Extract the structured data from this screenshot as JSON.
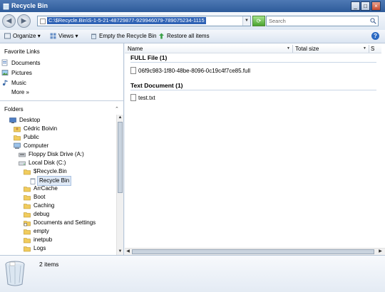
{
  "window": {
    "title": "Recycle Bin"
  },
  "address": {
    "path": "C:\\$Recycle.Bin\\S-1-5-21-48729877-929946079-789075234-1115",
    "search_placeholder": "Search"
  },
  "toolbar": {
    "organize": "Organize",
    "views": "Views",
    "empty": "Empty the Recycle Bin",
    "restore": "Restore all items"
  },
  "favorites": {
    "title": "Favorite Links",
    "items": [
      {
        "label": "Documents"
      },
      {
        "label": "Pictures"
      },
      {
        "label": "Music"
      }
    ],
    "more": "More"
  },
  "folders": {
    "title": "Folders",
    "tree": [
      {
        "label": "Desktop"
      },
      {
        "label": "Cédric Boivin"
      },
      {
        "label": "Public"
      },
      {
        "label": "Computer"
      },
      {
        "label": "Floppy Disk Drive (A:)"
      },
      {
        "label": "Local Disk (C:)"
      },
      {
        "label": "$Recycle.Bin"
      },
      {
        "label": "Recycle Bin"
      },
      {
        "label": "ArrCache"
      },
      {
        "label": "Boot"
      },
      {
        "label": "Caching"
      },
      {
        "label": "debug"
      },
      {
        "label": "Documents and Settings"
      },
      {
        "label": "empty"
      },
      {
        "label": "inetpub"
      },
      {
        "label": "Logs"
      }
    ]
  },
  "columns": {
    "name": "Name",
    "total_size": "Total size"
  },
  "groups": [
    {
      "title": "FULL File (1)",
      "files": [
        "06f9c983-1f80-48be-8096-0c19c4f7ce85.full"
      ]
    },
    {
      "title": "Text Document (1)",
      "files": [
        "test.txt"
      ]
    }
  ],
  "details": {
    "count": "2 items"
  }
}
